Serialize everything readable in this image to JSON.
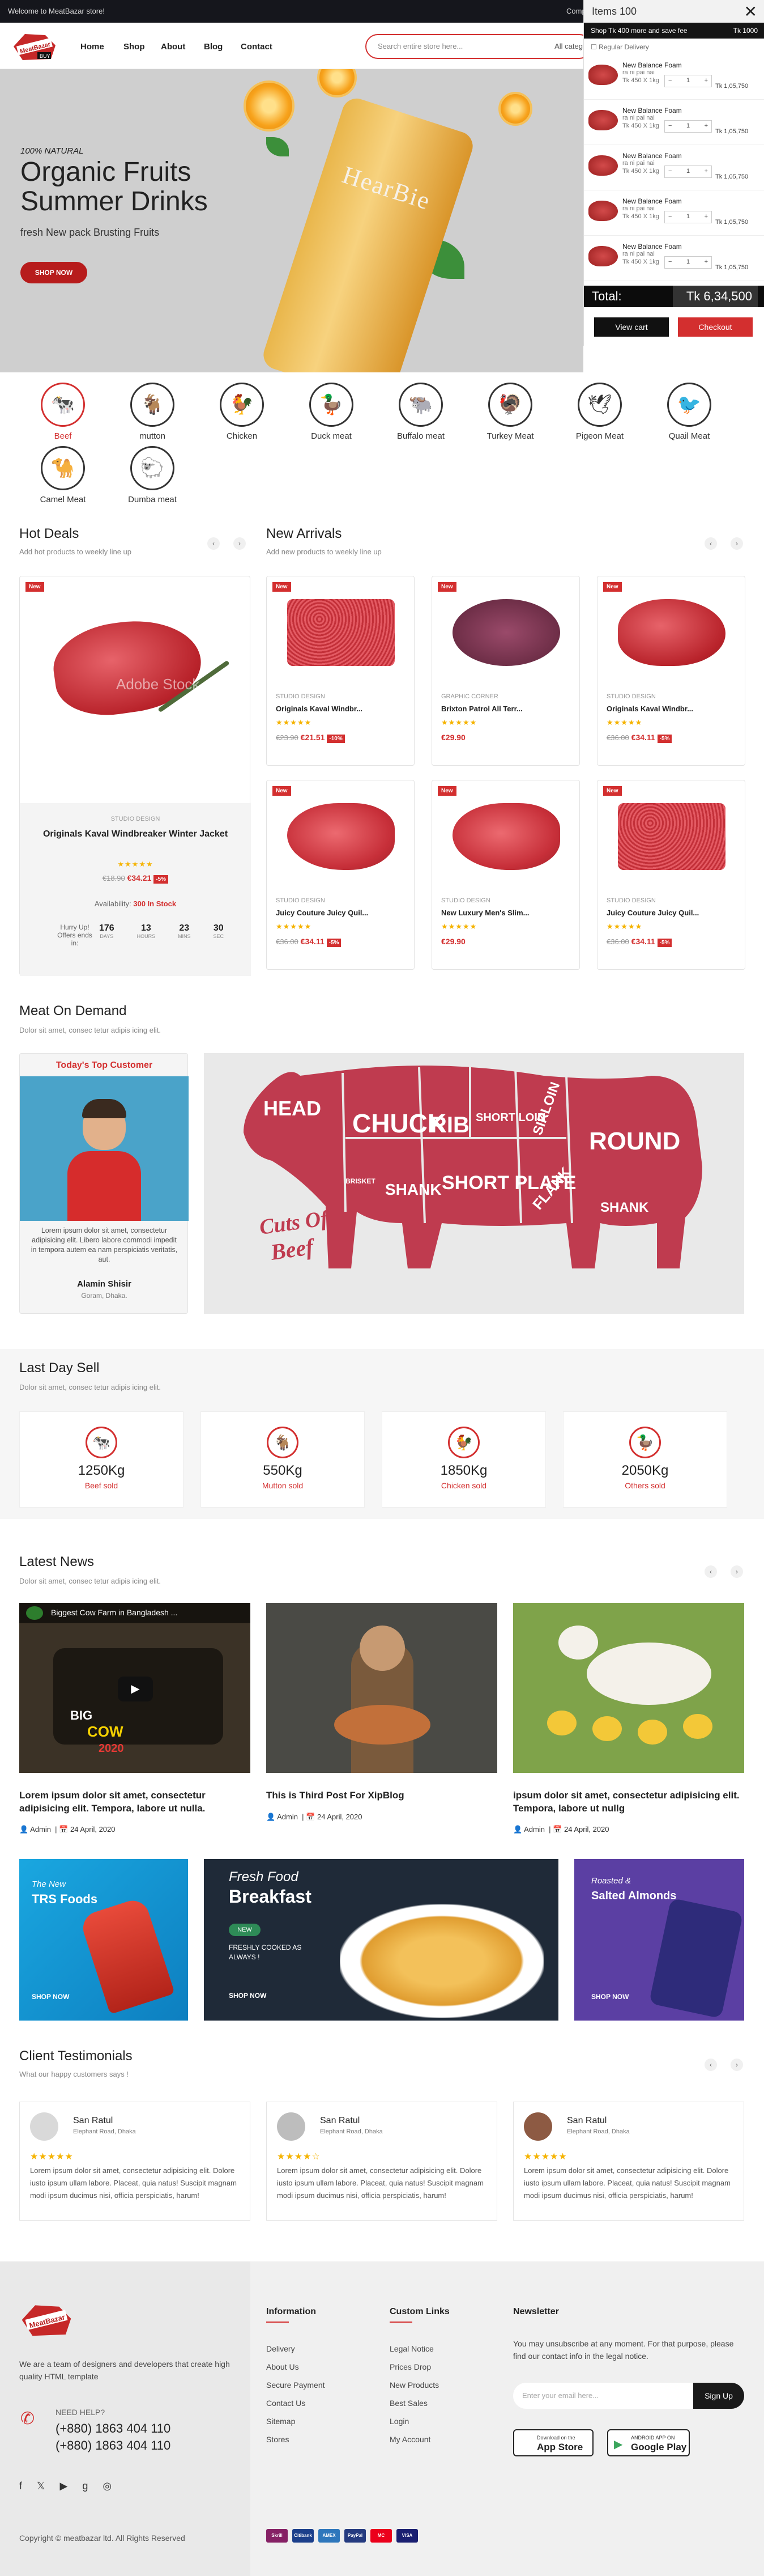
{
  "topbar": {
    "welcome": "Welcome to MeatBazar store!",
    "right_cut": "Comp"
  },
  "logo": {
    "text": "MeatBazar",
    "tag": "BUY"
  },
  "nav": {
    "items": [
      "Home",
      "Shop",
      "About",
      "Blog",
      "Contact"
    ]
  },
  "search": {
    "placeholder": "Search entire store here...",
    "category": "All categ"
  },
  "hero": {
    "tagline": "100% NATURAL",
    "heading": "Organic Fruits Summer Drinks",
    "subtitle": "fresh New pack Brusting Fruits",
    "button": "SHOP NOW",
    "bottle_label": "HearBie"
  },
  "cart": {
    "title": "Items 100",
    "promo_left": "Shop Tk 400 more and save fee",
    "promo_right": "Tk 1000",
    "delivery": "Regular Delivery",
    "items": [
      {
        "name": "New Balance Foam",
        "name2": "ra ni pai nai",
        "sub": "Tk 450 X 1kg",
        "qty": "1",
        "price": "Tk 1,05,750"
      },
      {
        "name": "New Balance Foam",
        "name2": "ra ni pai nai",
        "sub": "Tk 450 X 1kg",
        "qty": "1",
        "price": "Tk 1,05,750"
      },
      {
        "name": "New Balance Foam",
        "name2": "ra ni pai nai",
        "sub": "Tk 450 X 1kg",
        "qty": "1",
        "price": "Tk 1,05,750"
      },
      {
        "name": "New Balance Foam",
        "name2": "ra ni pai nai",
        "sub": "Tk 450 X 1kg",
        "qty": "1",
        "price": "Tk 1,05,750"
      },
      {
        "name": "New Balance Foam",
        "name2": "ra ni pai nai",
        "sub": "Tk 450 X 1kg",
        "qty": "1",
        "price": "Tk 1,05,750"
      }
    ],
    "total_label": "Total:",
    "total_value": "Tk 6,34,500",
    "view_cart": "View cart",
    "checkout": "Checkout"
  },
  "categories": [
    {
      "label": "Beef",
      "icon": "cow-icon",
      "glyph": "🐄",
      "active": true
    },
    {
      "label": "mutton",
      "icon": "goat-icon",
      "glyph": "🐐",
      "active": false
    },
    {
      "label": "Chicken",
      "icon": "chicken-icon",
      "glyph": "🐓",
      "active": false
    },
    {
      "label": "Duck meat",
      "icon": "duck-icon",
      "glyph": "🦆",
      "active": false
    },
    {
      "label": "Buffalo meat",
      "icon": "buffalo-icon",
      "glyph": "🐃",
      "active": false
    },
    {
      "label": "Turkey Meat",
      "icon": "turkey-icon",
      "glyph": "🦃",
      "active": false
    },
    {
      "label": "Pigeon Meat",
      "icon": "pigeon-icon",
      "glyph": "🕊",
      "active": false
    },
    {
      "label": "Quail Meat",
      "icon": "quail-icon",
      "glyph": "🐦",
      "active": false
    },
    {
      "label": "Camel Meat",
      "icon": "camel-icon",
      "glyph": "🐪",
      "active": false
    },
    {
      "label": "Dumba meat",
      "icon": "sheep-icon",
      "glyph": "🐑",
      "active": false
    }
  ],
  "hot_deals": {
    "title": "Hot Deals",
    "subtitle": "Add hot products to weekly line up",
    "badge": "New",
    "watermark": "Adobe Stock",
    "brand": "STUDIO DESIGN",
    "name": "Originals Kaval Windbreaker Winter Jacket",
    "stars": "★★★★★",
    "old_price": "€18.90",
    "new_price": "€34.21",
    "off": "-5%",
    "availability_label": "Availability:",
    "availability_value": "300 In Stock",
    "hurry": "Hurry Up! Offers ends in:",
    "countdown": [
      {
        "v": "176",
        "l": "DAYS"
      },
      {
        "v": "13",
        "l": "HOURS"
      },
      {
        "v": "23",
        "l": "MINS"
      },
      {
        "v": "30",
        "l": "SEC"
      }
    ]
  },
  "new_arrivals": {
    "title": "New Arrivals",
    "subtitle": "Add new products to weekly line up",
    "products": [
      {
        "badge": "New",
        "brand": "STUDIO DESIGN",
        "name": "Originals Kaval Windbr...",
        "stars": "★★★★★",
        "old": "€23.90",
        "new": "€21.51",
        "off": "-10%",
        "img": "mince"
      },
      {
        "badge": "New",
        "brand": "GRAPHIC CORNER",
        "name": "Brixton Patrol All Terr...",
        "stars": "★★★★★",
        "old": "",
        "new": "€29.90",
        "off": "",
        "img": "liver"
      },
      {
        "badge": "New",
        "brand": "STUDIO DESIGN",
        "name": "Originals Kaval Windbr...",
        "stars": "★★★★★",
        "old": "€36.00",
        "new": "€34.11",
        "off": "-5%",
        "img": "meat"
      },
      {
        "badge": "New",
        "brand": "STUDIO DESIGN",
        "name": "Juicy Couture Juicy Quil...",
        "stars": "★★★★★",
        "old": "€36.00",
        "new": "€34.11",
        "off": "-5%",
        "img": "steak"
      },
      {
        "badge": "New",
        "brand": "STUDIO DESIGN",
        "name": "New Luxury Men's Slim...",
        "stars": "★★★★★",
        "old": "",
        "new": "€29.90",
        "off": "",
        "img": "steak"
      },
      {
        "badge": "New",
        "brand": "STUDIO DESIGN",
        "name": "Juicy Couture Juicy Quil...",
        "stars": "★★★★★",
        "old": "€36.00",
        "new": "€34.11",
        "off": "-5%",
        "img": "mince"
      }
    ]
  },
  "meat_demand": {
    "title": "Meat On Demand",
    "subtitle": "Dolor sit amet, consec tetur adipis icing elit.",
    "customer_title": "Today's Top Customer",
    "customer_text": "Lorem ipsum dolor sit amet, consectetur adipisicing elit. Libero labore commodi impedit in tempora autem ea nam perspiciatis veritatis, aut.",
    "customer_name": "Alamin Shisir",
    "customer_location": "Goram, Dhaka.",
    "cuts": [
      "HEAD",
      "CHUCK",
      "RIB",
      "SHORT LOIN",
      "SIRLOIN",
      "ROUND",
      "BRISKET",
      "SHANK",
      "SHORT PLATE",
      "FLANK",
      "SHANK"
    ],
    "cuts_title_1": "Cuts Of",
    "cuts_title_2": "Beef"
  },
  "last_day_sell": {
    "title": "Last Day Sell",
    "subtitle": "Dolor sit amet, consec tetur adipis icing elit.",
    "stats": [
      {
        "value": "1250Kg",
        "label": "Beef sold",
        "icon": "cow-icon",
        "glyph": "🐄"
      },
      {
        "value": "550Kg",
        "label": "Mutton sold",
        "icon": "goat-icon",
        "glyph": "🐐"
      },
      {
        "value": "1850Kg",
        "label": "Chicken sold",
        "icon": "chicken-icon",
        "glyph": "🐓"
      },
      {
        "value": "2050Kg",
        "label": "Others sold",
        "icon": "duck-icon",
        "glyph": "🦆"
      }
    ]
  },
  "latest_news": {
    "title": "Latest News",
    "subtitle": "Dolor sit amet, consec tetur adipis icing elit.",
    "video_title": "Biggest Cow Farm in Bangladesh ...",
    "video_overlay_1": "BIG",
    "video_overlay_2": "COW",
    "video_overlay_3": "2020",
    "posts": [
      {
        "title": "Lorem ipsum dolor sit amet, consectetur adipisicing elit. Tempora, labore ut nulla.",
        "author": "Admin",
        "date": "24 April, 2020"
      },
      {
        "title": "This is Third Post For XipBlog",
        "author": "Admin",
        "date": "24 April, 2020"
      },
      {
        "title": "ipsum dolor sit amet, consectetur adipisicing elit. Tempora, labore ut nullg",
        "author": "Admin",
        "date": "24 April, 2020"
      }
    ]
  },
  "banners": [
    {
      "kicker": "The New",
      "title": "TRS Foods",
      "button": "SHOP NOW"
    },
    {
      "kicker": "Fresh Food",
      "title": "Breakfast",
      "tag": "NEW",
      "text": "FRESHLY COOKED AS ALWAYS !",
      "button": "SHOP NOW"
    },
    {
      "kicker": "Roasted &",
      "title": "Salted Almonds",
      "button": "SHOP NOW"
    }
  ],
  "testimonials": {
    "title": "Client Testimonials",
    "subtitle": "What our happy customers says !",
    "items": [
      {
        "name": "San Ratul",
        "location": "Elephant Road, Dhaka",
        "stars": "★★★★★",
        "text": "Lorem ipsum dolor sit amet, consectetur adipisicing elit. Dolore iusto ipsum ullam labore. Placeat, quia natus! Suscipit magnam modi ipsum ducimus nisi, officia perspiciatis, harum!"
      },
      {
        "name": "San Ratul",
        "location": "Elephant Road, Dhaka",
        "stars": "★★★★☆",
        "text": "Lorem ipsum dolor sit amet, consectetur adipisicing elit. Dolore iusto ipsum ullam labore. Placeat, quia natus! Suscipit magnam modi ipsum ducimus nisi, officia perspiciatis, harum!"
      },
      {
        "name": "San Ratul",
        "location": "Elephant Road, Dhaka",
        "stars": "★★★★★",
        "text": "Lorem ipsum dolor sit amet, consectetur adipisicing elit. Dolore iusto ipsum ullam labore. Placeat, quia natus! Suscipit magnam modi ipsum ducimus nisi, officia perspiciatis, harum!"
      }
    ]
  },
  "footer": {
    "about": "We are a team of designers and developers that create high quality HTML template",
    "need_help": "NEED HELP?",
    "phone1": "(+880) 1863 404 110",
    "phone2": "(+880) 1863 404 110",
    "info_title": "Information",
    "info_links": [
      "Delivery",
      "About Us",
      "Secure Payment",
      "Contact Us",
      "Sitemap",
      "Stores"
    ],
    "custom_title": "Custom Links",
    "custom_links": [
      "Legal Notice",
      "Prices Drop",
      "New Products",
      "Best Sales",
      "Login",
      "My Account"
    ],
    "newsletter_title": "Newsletter",
    "newsletter_text": "You may unsubscribe at any moment. For that purpose, please find our contact info in the legal notice.",
    "email_placeholder": "Enter your email here...",
    "signup": "Sign Up",
    "appstore_small": "Download on the",
    "appstore": "App Store",
    "googleplay_small": "ANDROID APP ON",
    "googleplay": "Google Play",
    "copyright": "Copyright © meatbazar ltd. All Rights Reserved",
    "payments": [
      {
        "label": "Skrill",
        "color": "#862165"
      },
      {
        "label": "Citibank",
        "color": "#1b3f8b"
      },
      {
        "label": "AMEX",
        "color": "#2e77bc"
      },
      {
        "label": "PayPal",
        "color": "#253b80"
      },
      {
        "label": "MC",
        "color": "#eb001b"
      },
      {
        "label": "VISA",
        "color": "#1a1f71"
      }
    ]
  },
  "colors": {
    "accent": "#d32f2f",
    "dark": "#15161c"
  }
}
